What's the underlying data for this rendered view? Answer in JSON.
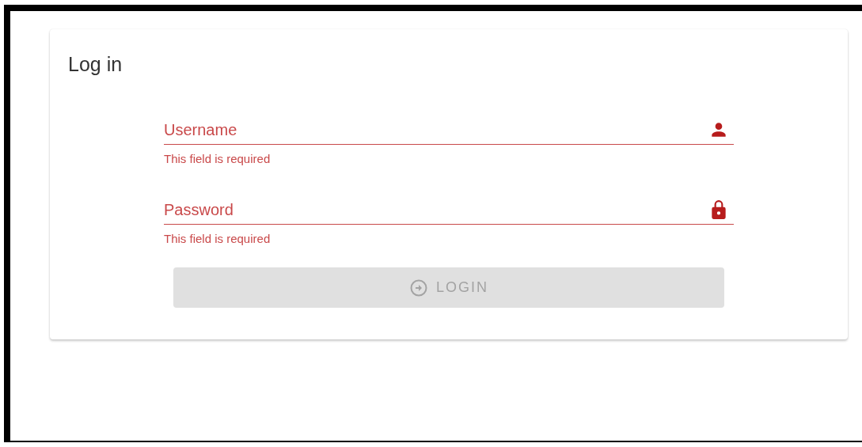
{
  "card": {
    "title": "Log in"
  },
  "fields": [
    {
      "kind": "person",
      "label": "Username",
      "error": true,
      "message": "This field is required"
    },
    {
      "kind": "lock",
      "label": "Password",
      "error": true,
      "message": "This field is required"
    }
  ],
  "button": {
    "label": "LOGIN",
    "disabled": true
  }
}
